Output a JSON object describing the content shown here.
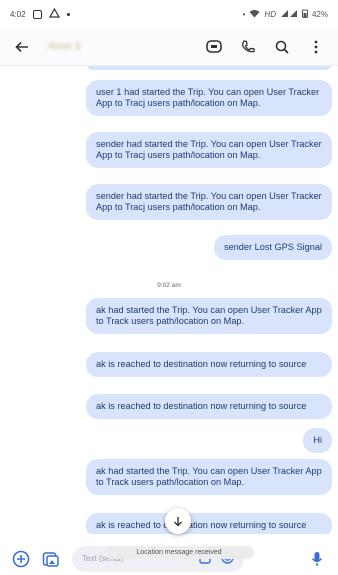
{
  "status_bar": {
    "time": "4:02",
    "network": "HD",
    "battery": "42%"
  },
  "header": {
    "contact_name": "Anna S",
    "icons": [
      "back-arrow-icon",
      "chat-icon",
      "phone-icon",
      "search-icon",
      "more-icon"
    ]
  },
  "messages": [
    {
      "text": "user 1 had started the Trip. You can open User Tracker App to Tracj users path/location on Map."
    },
    {
      "text": "sender had started the Trip. You can open User Tracker App to Tracj users path/location on Map."
    },
    {
      "text": "sender had started the Trip. You can open User Tracker App to Tracj users path/location on Map."
    },
    {
      "text": "sender Lost GPS Signal"
    },
    {
      "text": "ak had started the Trip. You can open User Tracker App to Track users path/location on Map."
    },
    {
      "text": "ak is reached to destination now returning to source"
    },
    {
      "text": "ak is reached to destination now returning to source"
    },
    {
      "text": "Hi"
    },
    {
      "text": "ak had started the Trip. You can open User Tracker App to Track users path/location on Map."
    },
    {
      "text": "ak is reached to destination now returning to source"
    }
  ],
  "timestamp": "9:02 am",
  "toast": "Location message received",
  "composer": {
    "placeholder": "Text (serial)"
  }
}
